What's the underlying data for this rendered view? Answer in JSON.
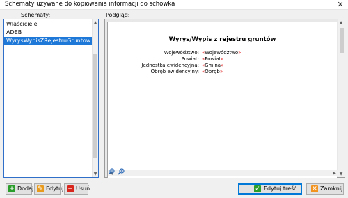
{
  "window": {
    "title": "Schematy używane do kopiowania informacji do schowka",
    "close_glyph": "✕"
  },
  "left": {
    "label": "Schematy:",
    "items": [
      {
        "label": "Właściciele"
      },
      {
        "label": "ADEB"
      },
      {
        "label": "WyrysWypisZRejestruGruntow"
      }
    ],
    "selected_index": 2
  },
  "preview": {
    "label": "Podgląd:",
    "doc_title": "Wyrys/Wypis z rejestru gruntów",
    "fields": [
      {
        "label": "Województwo:",
        "value": "Województwo"
      },
      {
        "label": "Powiat:",
        "value": "Powiat"
      },
      {
        "label": "Jednostka ewidencyjna:",
        "value": "Gmina"
      },
      {
        "label": "Obręb ewidencyjny:",
        "value": "Obręb"
      }
    ],
    "quote_open": "«",
    "quote_close": "»"
  },
  "buttons": {
    "add": "Dodaj",
    "edit": "Edytuj",
    "delete": "Usuń",
    "edit_content": "Edytuj treść",
    "close": "Zamknij"
  },
  "colors": {
    "selection": "#1e78d7",
    "add_icon": "#2a9d2a",
    "edit_icon": "#e79a1c",
    "delete_icon": "#d9261c",
    "placeholder_quote": "#dd0000"
  }
}
